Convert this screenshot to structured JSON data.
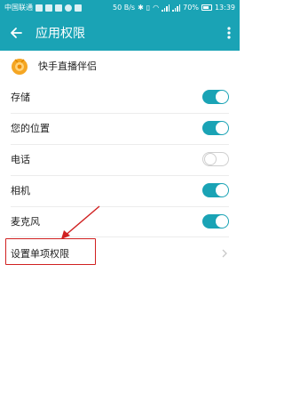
{
  "status_bar": {
    "carrier": "中国联通",
    "speed": "50 B/s",
    "battery": "70%",
    "time": "13:39"
  },
  "app_bar": {
    "title": "应用权限",
    "back_icon": "arrow-left-icon",
    "more_icon": "more-vertical-icon"
  },
  "app": {
    "name": "快手直播伴侣"
  },
  "permissions": [
    {
      "label": "存储",
      "enabled": true
    },
    {
      "label": "您的位置",
      "enabled": true
    },
    {
      "label": "电话",
      "enabled": false
    },
    {
      "label": "相机",
      "enabled": true
    },
    {
      "label": "麦克风",
      "enabled": true
    }
  ],
  "single_permission": {
    "label": "设置单项权限"
  },
  "colors": {
    "accent": "#1aa3b5",
    "annotation": "#d02020"
  }
}
